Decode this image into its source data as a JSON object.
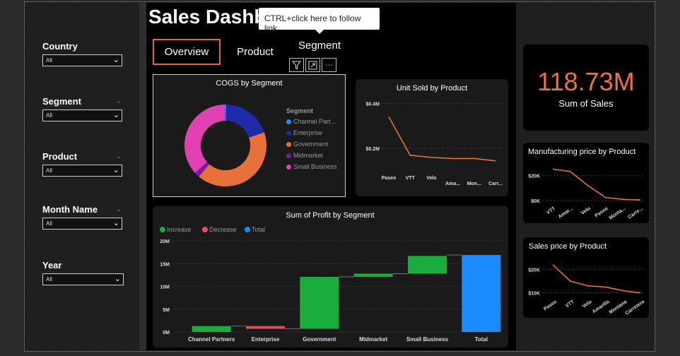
{
  "header": {
    "title": "Sales Dashb"
  },
  "tooltip": {
    "text": "CTRL+click here to follow link"
  },
  "tabs": [
    {
      "label": "Overview"
    },
    {
      "label": "Product"
    },
    {
      "label": "Segment"
    }
  ],
  "visual_tools": {
    "filter": "filter-icon",
    "focus": "focus-mode-icon",
    "more": "···"
  },
  "slicers": [
    {
      "title": "Country",
      "value": "All"
    },
    {
      "title": "Segment",
      "value": "All"
    },
    {
      "title": "Product",
      "value": "All"
    },
    {
      "title": "Month Name",
      "value": "All"
    },
    {
      "title": "Year",
      "value": "All"
    }
  ],
  "kpi": {
    "value": "118.73M",
    "label": "Sum of  Sales"
  },
  "colors": {
    "accent": "#e06a3e",
    "line": "#e8703a",
    "increase": "#1aac3c",
    "decrease": "#e0505e",
    "total": "#1a8cff"
  },
  "chart_data": [
    {
      "type": "pie",
      "title": "COGS by Segment",
      "legend_title": "Segment",
      "categories": [
        "Channel Part...",
        "Enterprise",
        "Government",
        "Midmarket",
        "Small Business"
      ],
      "values": [
        0.6,
        19.5,
        41.5,
        2.0,
        36.4
      ],
      "colors": [
        "#1a8cff",
        "#1c2ca8",
        "#e8703a",
        "#7a1aa0",
        "#e040b0"
      ]
    },
    {
      "type": "line",
      "title": "Unit Sold by Product",
      "categories": [
        "Paseo",
        "VTT",
        "Velo",
        "Ama...",
        "Mon...",
        "Carr..."
      ],
      "values": [
        0.34,
        0.17,
        0.16,
        0.155,
        0.155,
        0.145
      ],
      "ytick_labels": [
        "$0.4M",
        "$0.2M"
      ],
      "yticks": [
        0.4,
        0.2
      ],
      "ylim": [
        0.1,
        0.42
      ]
    },
    {
      "type": "bar",
      "title": "Sum of Profit by Segment",
      "legend": [
        "Increase",
        "Decrease",
        "Total"
      ],
      "categories": [
        "Channel Partners",
        "Enterprise",
        "Government",
        "Midmarket",
        "Small Business",
        "Total"
      ],
      "values": [
        1.3,
        -0.6,
        11.4,
        0.7,
        3.9,
        16.9
      ],
      "kinds": [
        "increase",
        "decrease",
        "increase",
        "increase",
        "increase",
        "total"
      ],
      "ytick_labels": [
        "20M",
        "15M",
        "10M",
        "5M",
        "0M"
      ],
      "yticks": [
        20,
        15,
        10,
        5,
        0
      ],
      "ylim": [
        0,
        20
      ]
    },
    {
      "type": "line",
      "title": "Manufacturing price by Product",
      "categories": [
        "VTT",
        "Amar...",
        "Velo",
        "Paseo",
        "Monta...",
        "Carre..."
      ],
      "values": [
        250,
        230,
        120,
        25,
        10,
        5
      ],
      "ytick_labels": [
        "$20K",
        "$0K"
      ],
      "yticks": [
        200,
        0
      ],
      "ylim": [
        0,
        280
      ]
    },
    {
      "type": "line",
      "title": "Sales price by Product",
      "categories": [
        "Paseo",
        "VTT",
        "Velo",
        "Amarilla",
        "Montana",
        "Carretera"
      ],
      "values": [
        22,
        15,
        13,
        12.5,
        11,
        10
      ],
      "ytick_labels": [
        "$20K",
        "$10K"
      ],
      "yticks": [
        20,
        10
      ],
      "ylim": [
        9,
        24
      ]
    }
  ]
}
